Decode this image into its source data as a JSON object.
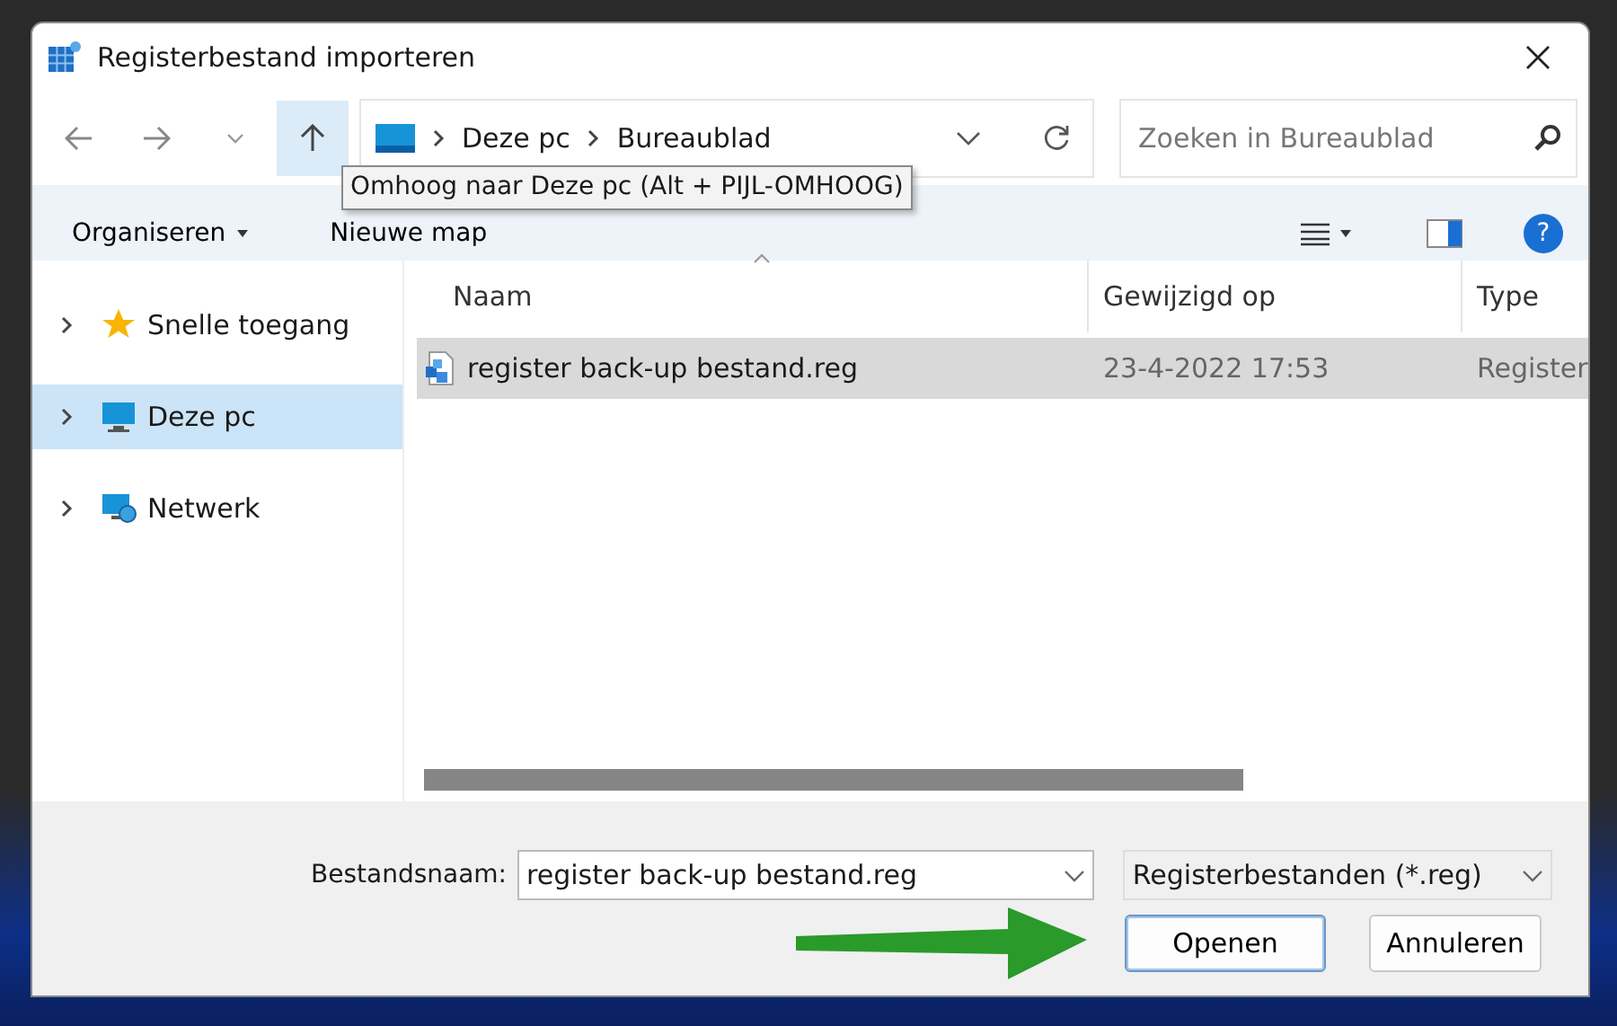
{
  "window": {
    "title": "Registerbestand importeren"
  },
  "address": {
    "crumbs": [
      "Deze pc",
      "Bureaublad"
    ]
  },
  "search": {
    "placeholder": "Zoeken in Bureaublad"
  },
  "tooltip": "Omhoog naar Deze pc (Alt + PIJL-OMHOOG)",
  "toolbar": {
    "organize": "Organiseren",
    "new_folder": "Nieuwe map",
    "help": "?"
  },
  "sidebar": {
    "items": [
      {
        "label": "Snelle toegang",
        "kind": "star",
        "selected": false,
        "expanded": false
      },
      {
        "label": "Deze pc",
        "kind": "pc",
        "selected": true,
        "expanded": false
      },
      {
        "label": "Netwerk",
        "kind": "network",
        "selected": false,
        "expanded": false
      }
    ]
  },
  "table": {
    "columns": [
      {
        "label": "Naam",
        "sorted": true
      },
      {
        "label": "Gewijzigd op",
        "sorted": false
      },
      {
        "label": "Type",
        "sorted": false
      }
    ],
    "rows": [
      {
        "name": "register back-up bestand.reg",
        "modified": "23-4-2022 17:53",
        "type": "Register",
        "selected": true
      }
    ]
  },
  "footer": {
    "filename_label": "Bestandsnaam:",
    "filename": "register back-up bestand.reg",
    "filter": "Registerbestanden (*.reg)",
    "buttons": [
      {
        "label": "Openen",
        "default": true
      },
      {
        "label": "Annuleren",
        "default": false
      }
    ]
  }
}
